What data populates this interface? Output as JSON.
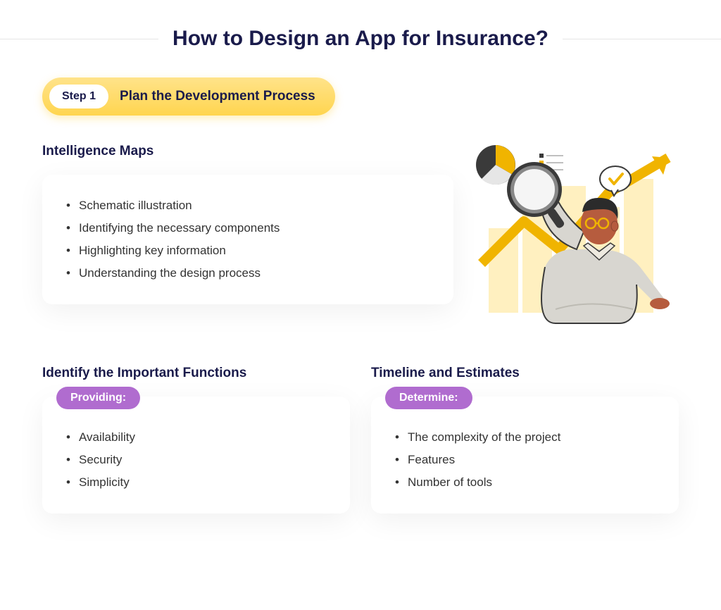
{
  "title": "How to Design an App for Insurance?",
  "step": {
    "badge": "Step 1",
    "label": "Plan the Development Process"
  },
  "sections": {
    "intelligence": {
      "title": "Intelligence Maps",
      "items": [
        "Schematic illustration",
        "Identifying the necessary components",
        "Highlighting key information",
        "Understanding the design process"
      ]
    },
    "functions": {
      "title": "Identify the Important Functions",
      "badge": "Providing:",
      "items": [
        "Availability",
        "Security",
        "Simplicity"
      ]
    },
    "timeline": {
      "title": "Timeline and Estimates",
      "badge": "Determine:",
      "items": [
        "The complexity of the project",
        "Features",
        "Number of tools"
      ]
    }
  },
  "colors": {
    "accent_yellow": "#ffd54f",
    "accent_purple": "#b06ccf",
    "text_dark": "#1a1b4b"
  },
  "illustration": {
    "semantic": "person-with-magnifying-glass-analytics",
    "elements": [
      "pie-chart",
      "bar-chart",
      "arrow-up",
      "checkmark-bubble",
      "magnifying-glass",
      "person"
    ]
  }
}
